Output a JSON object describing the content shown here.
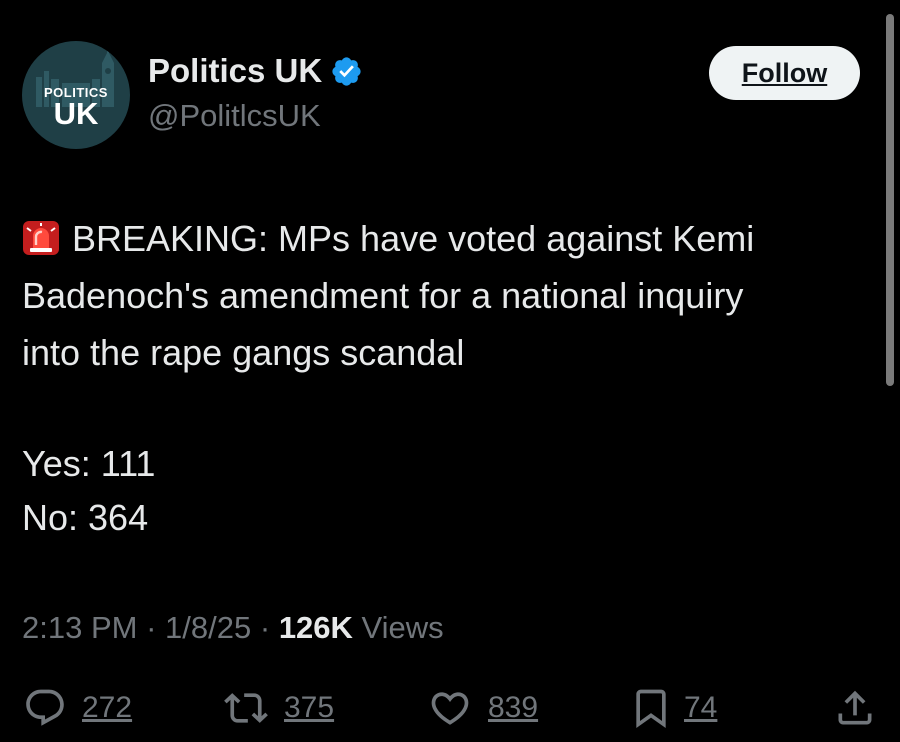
{
  "account": {
    "display_name": "Politics UK",
    "handle": "@PolitlcsUK",
    "verified": true,
    "avatar_text_top": "POLITICS",
    "avatar_text_bottom": "UK"
  },
  "follow_label": "Follow",
  "tweet": {
    "lines": [
      "BREAKING: MPs have voted against Kemi",
      "Badenoch's amendment for a national inquiry",
      "into the rape gangs scandal"
    ],
    "yes_line": "Yes: 111",
    "no_line": "No: 364"
  },
  "meta": {
    "time": "2:13 PM",
    "date": "1/8/25",
    "views_count": "126K",
    "views_label": "Views",
    "separator": "·"
  },
  "actions": {
    "replies": "272",
    "reposts": "375",
    "likes": "839",
    "bookmarks": "74"
  },
  "colors": {
    "background": "#000000",
    "text": "#e7e9ea",
    "secondary": "#71767b",
    "verified": "#1d9bf0",
    "follow_bg": "#eff3f4"
  }
}
